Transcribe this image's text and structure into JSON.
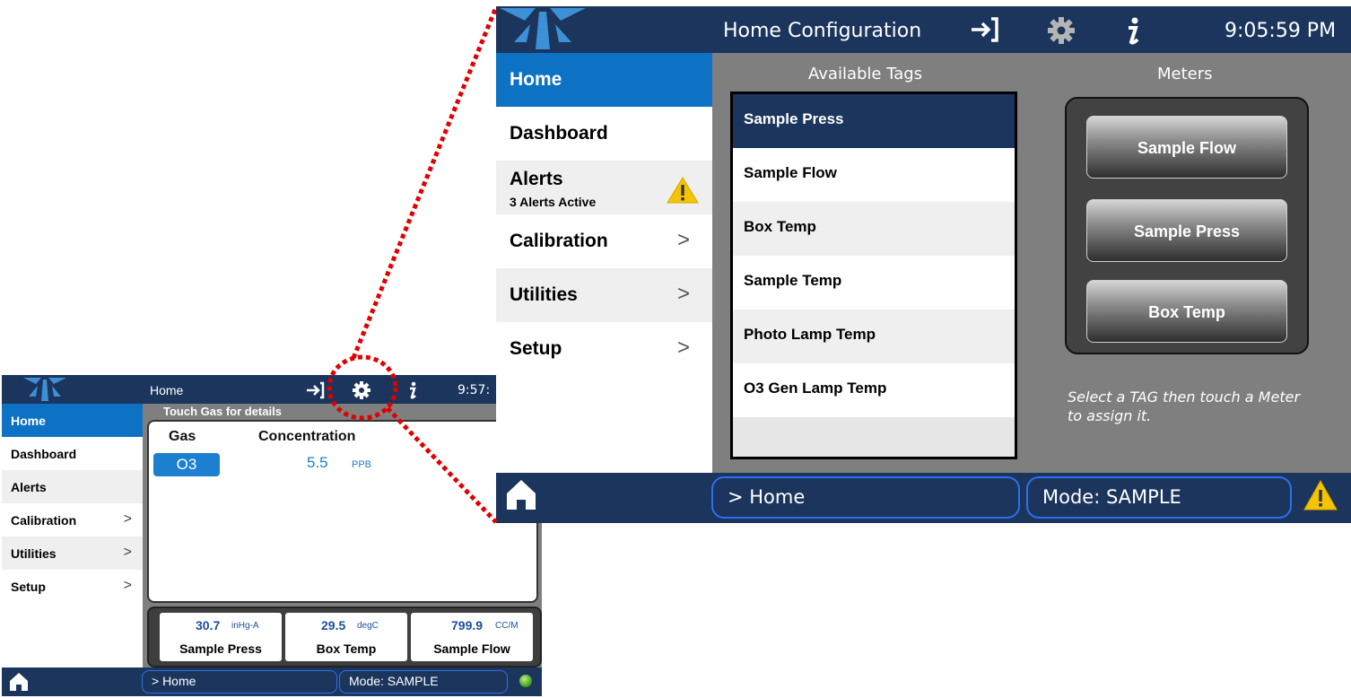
{
  "small_screen": {
    "title": "Home",
    "time": "9:57:",
    "menu": [
      {
        "label": "Home"
      },
      {
        "label": "Dashboard"
      },
      {
        "label": "Alerts"
      },
      {
        "label": "Calibration",
        "chevron": ">"
      },
      {
        "label": "Utilities",
        "chevron": ">"
      },
      {
        "label": "Setup",
        "chevron": ">"
      }
    ],
    "strip_text": "Touch Gas for details",
    "table": {
      "gas_header": "Gas",
      "concentration_header": "Concentration",
      "gas": "O3",
      "value": "5.5",
      "unit": "PPB"
    },
    "meters": [
      {
        "value": "30.7",
        "unit": "inHg-A",
        "label": "Sample Press"
      },
      {
        "value": "29.5",
        "unit": "degC",
        "label": "Box Temp"
      },
      {
        "value": "799.9",
        "unit": "CC/M",
        "label": "Sample Flow"
      }
    ],
    "breadcrumb": "> Home",
    "mode": "Mode: SAMPLE"
  },
  "large_screen": {
    "title": "Home Configuration",
    "time": "9:05:59 PM",
    "menu": [
      {
        "label": "Home"
      },
      {
        "label": "Dashboard"
      },
      {
        "label": "Alerts",
        "sub": "3 Alerts Active"
      },
      {
        "label": "Calibration",
        "chevron": ">"
      },
      {
        "label": "Utilities",
        "chevron": ">"
      },
      {
        "label": "Setup",
        "chevron": ">"
      }
    ],
    "available_tags_heading": "Available Tags",
    "meters_heading": "Meters",
    "tags": [
      "Sample Press",
      "Sample Flow",
      "Box Temp",
      "Sample Temp",
      "Photo Lamp Temp",
      "O3 Gen Lamp Temp"
    ],
    "selected_tag": "Sample Press",
    "meter_buttons": [
      "Sample Flow",
      "Sample Press",
      "Box Temp"
    ],
    "hint": "Select a TAG then touch a Meter to assign it.",
    "breadcrumb": "> Home",
    "mode": "Mode: SAMPLE"
  },
  "colors": {
    "header_navy": "#1b355d",
    "active_blue": "#0d71c4",
    "panel_gray": "#7f7f7f",
    "callout_red": "#e00000",
    "warning_yellow": "#f5c400"
  },
  "icons": [
    "logo-icon",
    "login-icon",
    "gear-icon",
    "info-icon",
    "home-icon",
    "warning-icon",
    "status-led-icon"
  ]
}
